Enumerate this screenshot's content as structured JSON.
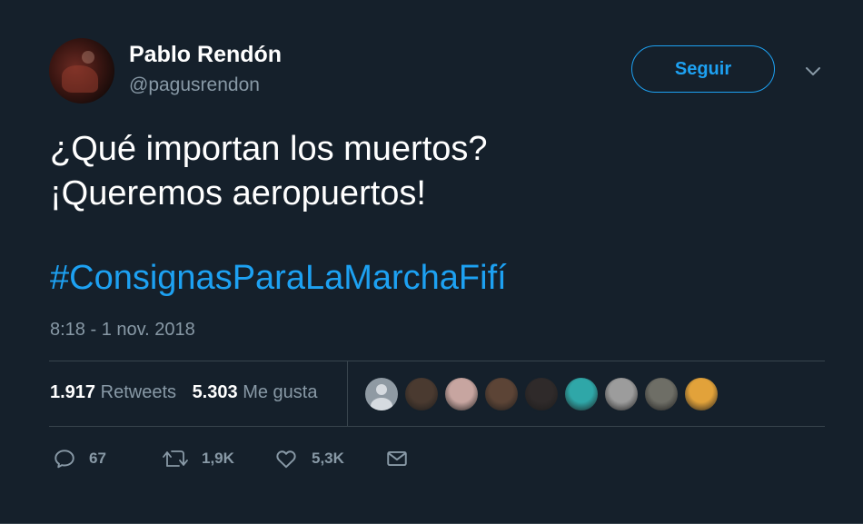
{
  "user": {
    "display_name": "Pablo Rendón",
    "handle": "@pagusrendon",
    "avatar_icon": "profile-photo"
  },
  "follow_button": {
    "label": "Seguir"
  },
  "menu_icon": "chevron-down-icon",
  "tweet": {
    "lines": [
      "¿Qué importan los muertos?",
      "¡Queremos aeropuertos!"
    ],
    "hashtag": "#ConsignasParaLaMarchaFifí",
    "timestamp": "8:18 - 1 nov. 2018"
  },
  "stats": {
    "retweets_count": "1.917",
    "retweets_label": "Retweets",
    "likes_count": "5.303",
    "likes_label": "Me gusta"
  },
  "liker_avatars": [
    {
      "kind": "default-silhouette"
    },
    {
      "kind": "photo",
      "color": "#4a3a30"
    },
    {
      "kind": "photo",
      "color": "#c7a5a0"
    },
    {
      "kind": "photo",
      "color": "#5c4436"
    },
    {
      "kind": "photo",
      "color": "#2f2a2a"
    },
    {
      "kind": "photo",
      "color": "#2fa7a8"
    },
    {
      "kind": "photo",
      "color": "#9c9c9c"
    },
    {
      "kind": "photo",
      "color": "#6e6e66"
    },
    {
      "kind": "photo",
      "color": "#e2a23a"
    }
  ],
  "actions": {
    "reply": {
      "icon": "reply-icon",
      "count": "67"
    },
    "retweet": {
      "icon": "retweet-icon",
      "count": "1,9K"
    },
    "like": {
      "icon": "heart-icon",
      "count": "5,3K"
    },
    "message": {
      "icon": "envelope-icon"
    }
  },
  "colors": {
    "background": "#15202b",
    "accent": "#1da1f2",
    "secondary_text": "#8899a6",
    "divider": "#38444d"
  }
}
